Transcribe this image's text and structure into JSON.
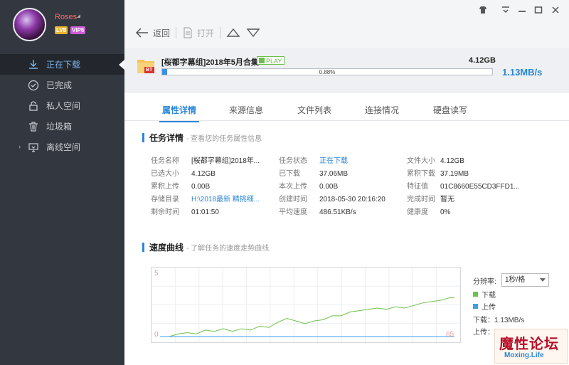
{
  "user": {
    "name": "Roses",
    "level": "LV8",
    "vip": "VIP6"
  },
  "sidebar": {
    "items": [
      {
        "label": "正在下载",
        "icon": "download-icon",
        "active": true
      },
      {
        "label": "已完成",
        "icon": "check-circle-icon",
        "active": false
      },
      {
        "label": "私人空间",
        "icon": "lock-icon",
        "active": false
      },
      {
        "label": "垃圾箱",
        "icon": "trash-icon",
        "active": false
      },
      {
        "label": "离线空间",
        "icon": "cloud-monitor-icon",
        "active": false
      }
    ]
  },
  "toolbar": {
    "back_label": "返回",
    "open_label": "打开"
  },
  "task": {
    "name": "[桜都字幕组]2018年5月合集",
    "play_label": "PLAY",
    "size": "4.12GB",
    "progress_text": "0.88%",
    "progress_fraction": 0.0088,
    "speed": "1.13MB/s",
    "file_type": "BT"
  },
  "tabs": [
    "属性详情",
    "来源信息",
    "文件列表",
    "连接情况",
    "硬盘读写"
  ],
  "details_section": {
    "title": "任务详情",
    "subtitle": "- 查看您的任务属性信息"
  },
  "details": {
    "col1": [
      {
        "label": "任务名称",
        "value": "[桜都字幕组]2018年..."
      },
      {
        "label": "已选大小",
        "value": "4.12GB"
      },
      {
        "label": "累积上传",
        "value": "0.00B"
      },
      {
        "label": "存储目录",
        "value": "H:\\2018最新 精挑细..."
      },
      {
        "label": "剩余时间",
        "value": "01:01:50"
      }
    ],
    "col2": [
      {
        "label": "任务状态",
        "value": "正在下载"
      },
      {
        "label": "已下载",
        "value": "37.06MB"
      },
      {
        "label": "本次上传",
        "value": "0.00B"
      },
      {
        "label": "创建时间",
        "value": "2018-05-30 20:16:20"
      },
      {
        "label": "平均速度",
        "value": "486.51KB/s"
      }
    ],
    "col3": [
      {
        "label": "文件大小",
        "value": "4.12GB"
      },
      {
        "label": "累积下载",
        "value": "37.19MB"
      },
      {
        "label": "特征值",
        "value": "01C8660E55CD3FFD1..."
      },
      {
        "label": "完成时间",
        "value": "暂无"
      },
      {
        "label": "健康度",
        "value": "0%"
      }
    ]
  },
  "speed_section": {
    "title": "速度曲线",
    "subtitle": "- 了解任务的速度走势曲线"
  },
  "chart_data": {
    "type": "line",
    "x": [
      0,
      2,
      4,
      6,
      8,
      10,
      12,
      14,
      16,
      18,
      20,
      22,
      24,
      26,
      28,
      30,
      32,
      34,
      36,
      38,
      40,
      42,
      44,
      46,
      48,
      50,
      52,
      54,
      56,
      58,
      60,
      62,
      64,
      65
    ],
    "series": [
      {
        "name": "下载",
        "values": [
          0,
          0,
          0.2,
          0.3,
          0.2,
          0.5,
          0.4,
          0.6,
          0.4,
          0.6,
          0.5,
          0.8,
          0.7,
          1.1,
          1.4,
          1.2,
          1.0,
          1.2,
          1.3,
          1.6,
          1.6,
          1.9,
          2.0,
          2.1,
          2.2,
          2.1,
          2.3,
          2.2,
          2.4,
          2.6,
          2.7,
          2.8,
          3.0,
          3.0
        ]
      },
      {
        "name": "上传",
        "values": [
          0,
          0,
          0,
          0,
          0,
          0,
          0,
          0,
          0,
          0,
          0,
          0,
          0,
          0,
          0,
          0,
          0,
          0,
          0,
          0,
          0,
          0,
          0,
          0,
          0,
          0,
          0,
          0,
          0,
          0,
          0,
          0,
          0,
          0
        ]
      }
    ],
    "xlim": [
      0,
      65
    ],
    "ylim": [
      0,
      5
    ],
    "y_top_label": "5",
    "y_bottom_label": "0",
    "x_right_label": "65",
    "grid": true,
    "colors": {
      "download": "#6cc24a",
      "upload": "#3aa0e8"
    }
  },
  "chart_controls": {
    "resolution_label": "分辨率:",
    "resolution_value": "1秒/格",
    "legend_download": "下载",
    "legend_upload": "上传",
    "download_speed": "下载：1.13MB/s",
    "upload_speed": "上传：0B/s"
  },
  "watermark": {
    "text": "魔性论坛",
    "url": "Moxing.Life"
  }
}
